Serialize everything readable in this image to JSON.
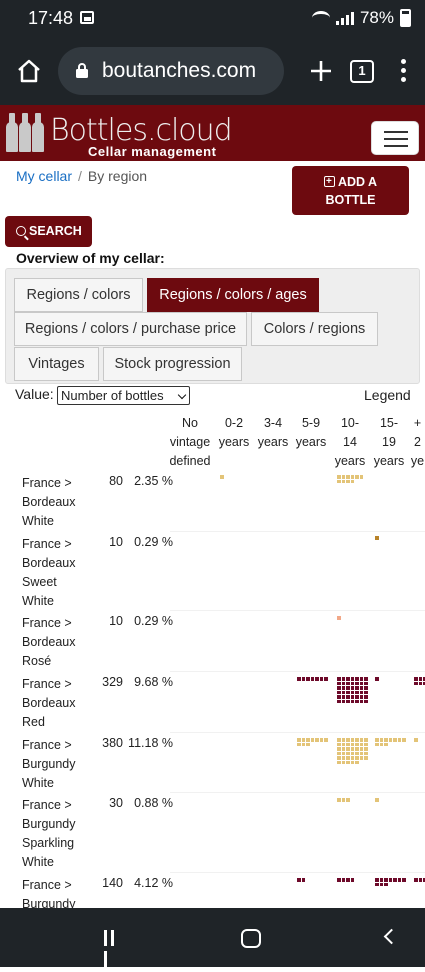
{
  "status_bar": {
    "time": "17:48",
    "battery": "78%"
  },
  "browser": {
    "url": "boutanches.com",
    "tab_count": "1"
  },
  "site": {
    "logo_text": "Bottles.cloud",
    "logo_subtitle": "Cellar management",
    "brand_color": "#6d0a0f"
  },
  "breadcrumb": {
    "home": "My cellar",
    "separator": "/",
    "current": "By region"
  },
  "buttons": {
    "add_bottle_line1": "ADD A",
    "add_bottle_line2": "BOTTLE",
    "search": "SEARCH"
  },
  "overview_title": "Overview of my cellar:",
  "tabs": [
    {
      "label": "Regions / colors",
      "active": false
    },
    {
      "label": "Regions / colors / ages",
      "active": true
    },
    {
      "label": "Regions / colors / purchase price",
      "active": false
    },
    {
      "label": "Colors / regions",
      "active": false
    },
    {
      "label": "Vintages",
      "active": false
    },
    {
      "label": "Stock progression",
      "active": false
    }
  ],
  "value_selector": {
    "label": "Value:",
    "selected": "Number of bottles"
  },
  "legend_label": "Legend",
  "age_columns": [
    {
      "line1": "No",
      "line2": "vintage",
      "line3": "defined"
    },
    {
      "line1": "0-2",
      "line2": "years",
      "line3": ""
    },
    {
      "line1": "3-4",
      "line2": "years",
      "line3": ""
    },
    {
      "line1": "5-9",
      "line2": "years",
      "line3": ""
    },
    {
      "line1": "10-",
      "line2": "14",
      "line3": "years"
    },
    {
      "line1": "15-",
      "line2": "19",
      "line3": "years"
    },
    {
      "line1": "+",
      "line2": "2",
      "line3": "ye"
    }
  ],
  "dot_colors": {
    "white": "#e3c478",
    "sweet_white": "#b8832a",
    "rose": "#f2a888",
    "red": "#6d0a2a"
  },
  "rows": [
    {
      "region_lines": [
        "France >",
        "Bordeaux",
        "White"
      ],
      "count": "80",
      "percent": "2.35 %"
    },
    {
      "region_lines": [
        "France >",
        "Bordeaux",
        "Sweet",
        "White"
      ],
      "count": "10",
      "percent": "0.29 %"
    },
    {
      "region_lines": [
        "France >",
        "Bordeaux",
        "Rosé"
      ],
      "count": "10",
      "percent": "0.29 %"
    },
    {
      "region_lines": [
        "France >",
        "Bordeaux",
        "Red"
      ],
      "count": "329",
      "percent": "9.68 %"
    },
    {
      "region_lines": [
        "France >",
        "Burgundy",
        "White"
      ],
      "count": "380",
      "percent": "11.18 %"
    },
    {
      "region_lines": [
        "France >",
        "Burgundy",
        "Sparkling",
        "White"
      ],
      "count": "30",
      "percent": "0.88 %"
    },
    {
      "region_lines": [
        "France >",
        "Burgundy"
      ],
      "count": "140",
      "percent": "4.12 %"
    }
  ]
}
